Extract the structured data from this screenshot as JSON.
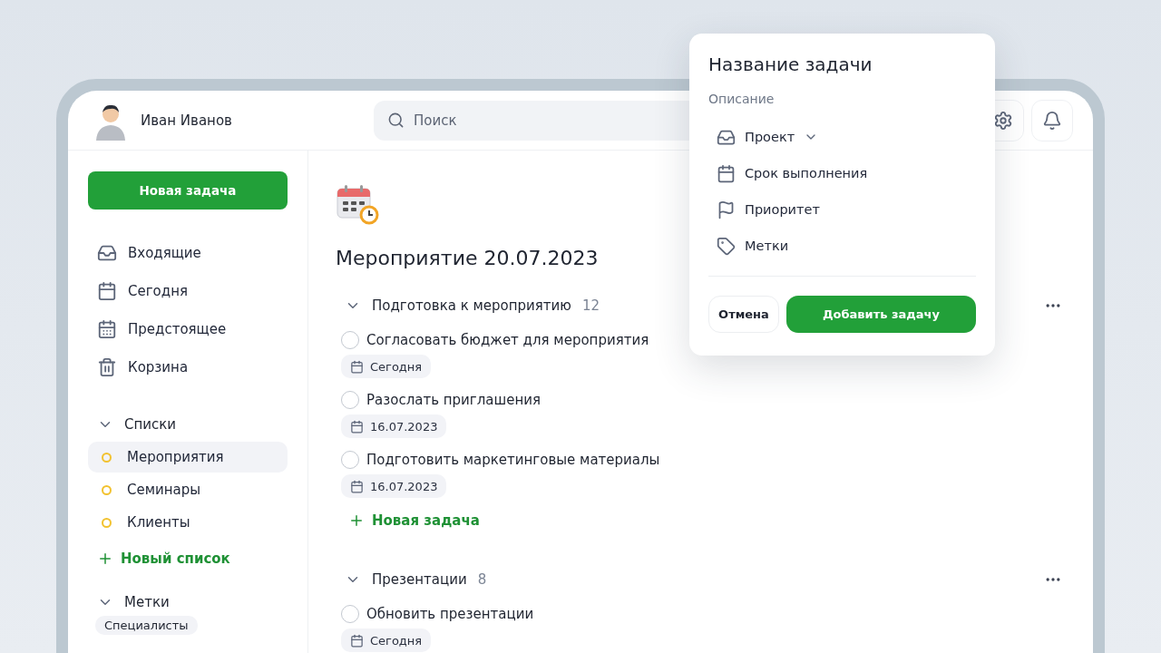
{
  "user": {
    "name": "Иван Иванов"
  },
  "search": {
    "placeholder": "Поиск"
  },
  "sidebar": {
    "new_task": "Новая задача",
    "nav": [
      {
        "label": "Входящие",
        "kind": "inbox",
        "selected": false
      },
      {
        "label": "Сегодня",
        "kind": "today",
        "selected": false
      },
      {
        "label": "Предстоящее",
        "kind": "upcoming",
        "selected": false
      },
      {
        "label": "Корзина",
        "kind": "trash",
        "selected": false
      }
    ],
    "lists": {
      "title": "Списки",
      "expanded": true,
      "items": [
        {
          "label": "Мероприятия",
          "color": "#f2c230",
          "selected": true
        },
        {
          "label": "Семинары",
          "color": "#f2c230",
          "selected": false
        },
        {
          "label": "Клиенты",
          "color": "#f2c230",
          "selected": false
        }
      ],
      "add": "Новый список"
    },
    "tags": {
      "title": "Метки",
      "expanded": true,
      "items": [
        "Специалисты"
      ]
    }
  },
  "project": {
    "title": "Мероприятие 20.07.2023",
    "sections": [
      {
        "title": "Подготовка к мероприятию",
        "count": "12",
        "expanded": true,
        "add": "Новая задача",
        "tasks": [
          {
            "title": "Согласовать бюджет для мероприятия",
            "checked": false,
            "due": "Сегодня"
          },
          {
            "title": "Разослать приглашения",
            "checked": false,
            "due": "16.07.2023"
          },
          {
            "title": "Подготовить маркетинговые материалы",
            "checked": false,
            "due": "16.07.2023"
          }
        ]
      },
      {
        "title": "Презентации",
        "count": "8",
        "expanded": true,
        "tasks": [
          {
            "title": "Обновить презентации",
            "checked": false,
            "due": "Сегодня"
          }
        ]
      }
    ]
  },
  "popup": {
    "title": "Название задачи",
    "description_placeholder": "Описание",
    "options": [
      {
        "kind": "project",
        "label": "Проект"
      },
      {
        "kind": "due",
        "label": "Срок выполнения"
      },
      {
        "kind": "priority",
        "label": "Приоритет"
      },
      {
        "kind": "tags",
        "label": "Метки"
      }
    ],
    "cancel": "Отмена",
    "submit": "Добавить задачу"
  }
}
